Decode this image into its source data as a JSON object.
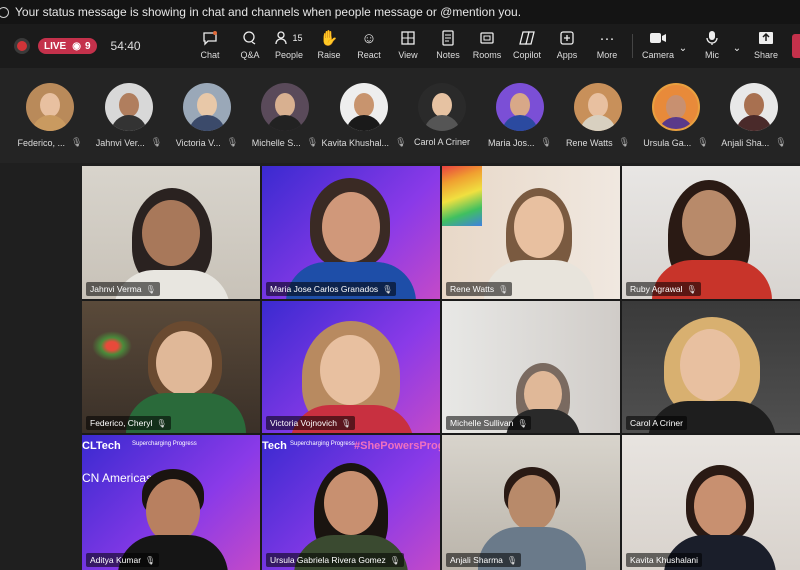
{
  "banner": {
    "message": "Your status message is showing in chat and channels when people message or @mention you."
  },
  "meeting": {
    "live_label": "LIVE",
    "viewer_count": "9",
    "elapsed": "54:40"
  },
  "toolbar": {
    "buttons": [
      {
        "label": "Chat",
        "icon": "chat-icon"
      },
      {
        "label": "Q&A",
        "icon": "qa-icon"
      },
      {
        "label": "People",
        "icon": "people-icon",
        "badge": "15"
      },
      {
        "label": "Raise",
        "icon": "raise-hand-icon"
      },
      {
        "label": "React",
        "icon": "react-icon"
      },
      {
        "label": "View",
        "icon": "view-icon"
      },
      {
        "label": "Notes",
        "icon": "notes-icon"
      },
      {
        "label": "Rooms",
        "icon": "rooms-icon"
      },
      {
        "label": "Copilot",
        "icon": "copilot-icon"
      },
      {
        "label": "Apps",
        "icon": "apps-icon"
      },
      {
        "label": "More",
        "icon": "more-icon"
      },
      {
        "label": "Camera",
        "icon": "camera-icon"
      },
      {
        "label": "Mic",
        "icon": "mic-icon"
      },
      {
        "label": "Share",
        "icon": "share-icon"
      }
    ]
  },
  "attendees": [
    {
      "name": "Federico, ..."
    },
    {
      "name": "Jahnvi Ver..."
    },
    {
      "name": "Victoria V..."
    },
    {
      "name": "Michelle S..."
    },
    {
      "name": "Kavita Khushal..."
    },
    {
      "name": "Carol A Criner"
    },
    {
      "name": "Maria Jos..."
    },
    {
      "name": "Rene Watts"
    },
    {
      "name": "Ursula Ga..."
    },
    {
      "name": "Anjali Sha..."
    }
  ],
  "video_tiles": [
    {
      "name": "Jahnvi Verma"
    },
    {
      "name": "Maria Jose Carlos Granados"
    },
    {
      "name": "Rene Watts"
    },
    {
      "name": "Ruby Agrawal"
    },
    {
      "name": "Federico, Cheryl"
    },
    {
      "name": "Victoria Vojnovich"
    },
    {
      "name": "Michelle Sullivan"
    },
    {
      "name": "Carol A Criner"
    },
    {
      "name": "Aditya Kumar"
    },
    {
      "name": "Ursula Gabriela Rivera Gomez"
    },
    {
      "name": "Anjali Sharma"
    },
    {
      "name": "Kavita Khushalani"
    }
  ],
  "backgrounds": {
    "aditya_brand": "CLTech",
    "aditya_tagline": "Supercharging Progress",
    "aditya_region": "CN Americas",
    "ursula_brand": "Tech",
    "ursula_tagline": "Supercharging Progress",
    "ursula_hashtag": "#ShePowersProg"
  },
  "colors": {
    "live": "#c4314b",
    "record": "#d13438",
    "accent_purple": "#7b4fd6"
  }
}
